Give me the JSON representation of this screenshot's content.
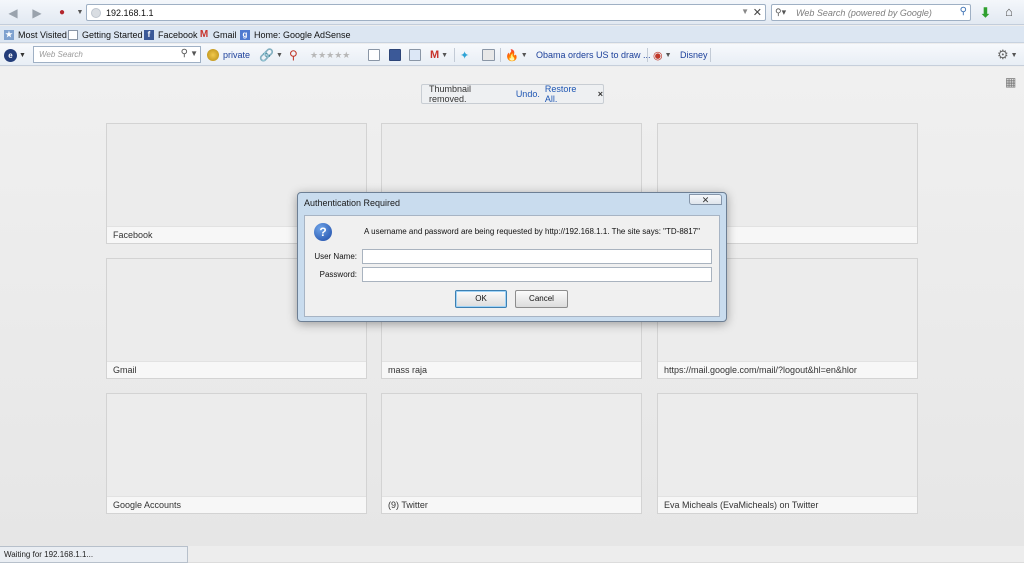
{
  "navbar": {
    "url": "192.168.1.1",
    "search_placeholder": "Web Search (powered by Google)"
  },
  "bookmarks": [
    {
      "label": "Most Visited"
    },
    {
      "label": "Getting Started"
    },
    {
      "label": "Facebook"
    },
    {
      "label": "Gmail"
    },
    {
      "label": "Home: Google AdSense"
    }
  ],
  "toolbar": {
    "search_placeholder": "Web Search",
    "private_label": "private",
    "news_label": "Obama orders US to draw ...",
    "disney_label": "Disney"
  },
  "notice": {
    "text": "Thumbnail removed.",
    "undo": "Undo.",
    "restore": "Restore All.",
    "close": "×"
  },
  "thumbnails": [
    {
      "label": "Facebook"
    },
    {
      "label": ""
    },
    {
      "label": ""
    },
    {
      "label": "Gmail"
    },
    {
      "label": "mass raja"
    },
    {
      "label": "https://mail.google.com/mail/?logout&hl=en&hlor"
    },
    {
      "label": "Google Accounts"
    },
    {
      "label": "(9) Twitter"
    },
    {
      "label": "Eva Micheals (EvaMicheals) on Twitter"
    }
  ],
  "dialog": {
    "title": "Authentication Required",
    "message": "A username and password are being requested by http://192.168.1.1. The site says: \"TD-8817\"",
    "username_label": "User Name:",
    "password_label": "Password:",
    "username_value": "",
    "password_value": "",
    "ok": "OK",
    "cancel": "Cancel"
  },
  "status": {
    "text": "Waiting for 192.168.1.1..."
  }
}
